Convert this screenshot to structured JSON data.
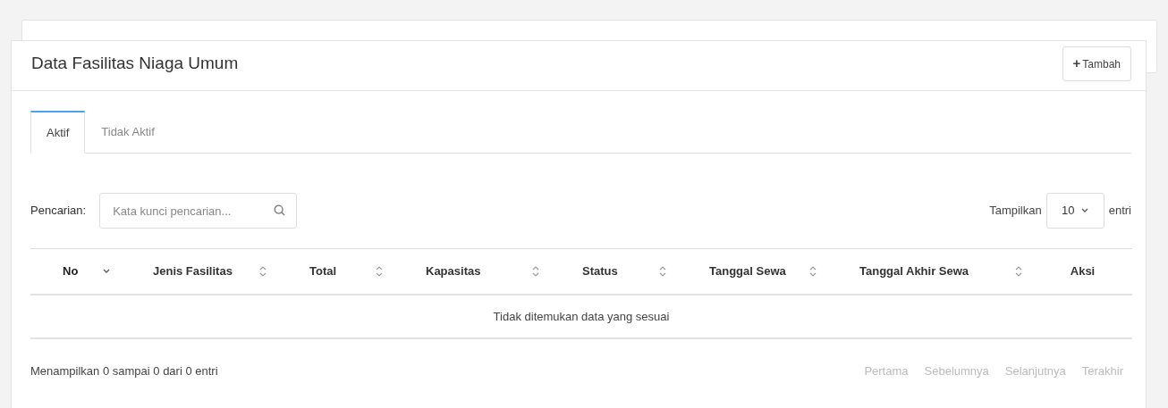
{
  "card": {
    "title": "Data Fasilitas Niaga Umum",
    "add_button": {
      "icon": "+",
      "label": "Tambah"
    }
  },
  "tabs": [
    {
      "label": "Aktif",
      "selected": true
    },
    {
      "label": "Tidak Aktif",
      "selected": false
    }
  ],
  "search": {
    "label": "Pencarian:",
    "placeholder": "Kata kunci pencarian..."
  },
  "page_size": {
    "label": "Tampilkan",
    "value": "10",
    "suffix": "entri"
  },
  "table": {
    "columns": [
      {
        "label": "No",
        "sortable": true,
        "sorted": true
      },
      {
        "label": "Jenis Fasilitas",
        "sortable": true,
        "sorted": false
      },
      {
        "label": "Total",
        "sortable": true,
        "sorted": false
      },
      {
        "label": "Kapasitas",
        "sortable": true,
        "sorted": false
      },
      {
        "label": "Status",
        "sortable": true,
        "sorted": false
      },
      {
        "label": "Tanggal Sewa",
        "sortable": true,
        "sorted": false
      },
      {
        "label": "Tanggal Akhir Sewa",
        "sortable": true,
        "sorted": false
      },
      {
        "label": "Aksi",
        "sortable": false,
        "sorted": false
      }
    ],
    "empty_message": "Tidak ditemukan data yang sesuai"
  },
  "info": "Menampilkan 0 sampai 0 dari 0 entri",
  "pagination": [
    {
      "label": "Pertama",
      "disabled": true
    },
    {
      "label": "Sebelumnya",
      "disabled": true
    },
    {
      "label": "Selanjutnya",
      "disabled": true
    },
    {
      "label": "Terakhir",
      "disabled": true
    }
  ]
}
